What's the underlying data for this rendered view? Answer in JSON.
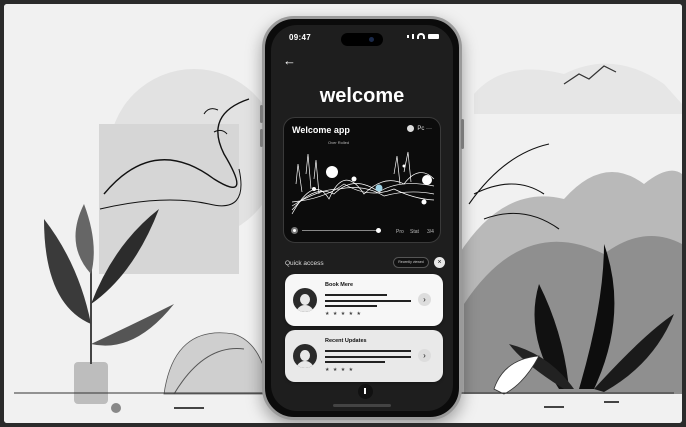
{
  "status": {
    "time": "09:47"
  },
  "header": {
    "back_icon": "back-arrow-icon",
    "title": "welcome"
  },
  "player_card": {
    "title": "Welcome app",
    "subtitle": "Over  Rolled",
    "icons": [
      "camera-icon",
      "more-icon"
    ],
    "icon_text": "Pc  ···",
    "controls": [
      "Pro",
      "Stat",
      "3/4"
    ]
  },
  "quick_access": {
    "label": "Quick access",
    "pill": "Recently viewed",
    "close_icon": "close-icon"
  },
  "list": [
    {
      "title": "Book Mere",
      "stars": "★ ★ ★ ★ ★",
      "arrow": "›"
    },
    {
      "title": "Recent Updates",
      "stars": "★ ★ ★ ★",
      "arrow": "›"
    }
  ],
  "colors": {
    "screen": "#1e1e1e",
    "card_light": "#f7f7f7",
    "accent_dot": "#9fd3e6"
  }
}
